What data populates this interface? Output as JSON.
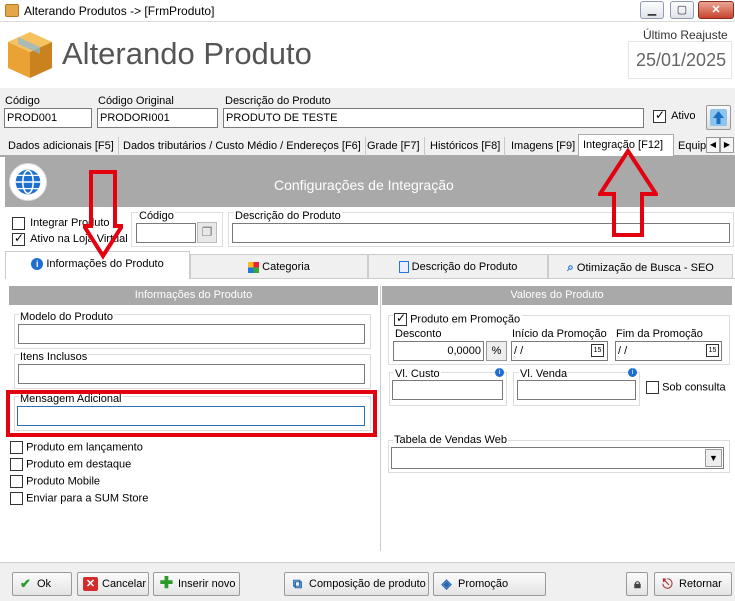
{
  "window": {
    "title": "Alterando Produtos  ->  [FrmProduto]",
    "minimize": "▁",
    "maximize": "▢",
    "close": "✕"
  },
  "header": {
    "page_title": "Alterando Produto",
    "reajuste_label": "Último Reajuste",
    "reajuste_value": "25/01/2025"
  },
  "fields": {
    "codigo_label": "Código",
    "codigo_value": "PROD001",
    "codigo_original_label": "Código Original",
    "codigo_original_value": "PRODORI001",
    "descricao_label": "Descrição do Produto",
    "descricao_value": "PRODUTO DE TESTE",
    "ativo_label": "Ativo"
  },
  "tabs": [
    {
      "label": "Dados adicionais [F5]"
    },
    {
      "label": "Dados tributários / Custo Médio / Endereços [F6]"
    },
    {
      "label": "Grade [F7]"
    },
    {
      "label": "Históricos [F8]"
    },
    {
      "label": "Imagens [F9]"
    },
    {
      "label": "Integração [F12]"
    },
    {
      "label": "Equip"
    }
  ],
  "integracao": {
    "title": "Configurações de Integração",
    "integrar_produto": "Integrar Produto",
    "ativo_loja_virtual": "Ativo na Loja Virtual",
    "codigo_label": "Código",
    "descricao_label": "Descrição do Produto"
  },
  "subtabs": [
    {
      "label": "Informações do Produto"
    },
    {
      "label": "Categoria"
    },
    {
      "label": "Descrição do Produto"
    },
    {
      "label": "Otimização de Busca - SEO"
    }
  ],
  "info_produto": {
    "header": "Informações do Produto",
    "modelo_label": "Modelo do Produto",
    "itens_label": "Itens Inclusos",
    "mensagem_label": "Mensagem Adicional",
    "checks": [
      "Produto em lançamento",
      "Produto em destaque",
      "Produto Mobile",
      "Enviar para a SUM Store"
    ]
  },
  "valores": {
    "header": "Valores do Produto",
    "promocao_label": "Produto em Promoção",
    "desconto_label": "Desconto",
    "desconto_value": "0,0000",
    "percent": "%",
    "inicio_label": "Início da Promoção",
    "inicio_value": " / /",
    "fim_label": "Fim da Promoção",
    "fim_value": " / /",
    "custo_label": "Vl. Custo",
    "venda_label": "Vl. Venda",
    "sob_consulta": "Sob consulta",
    "tabela_label": "Tabela de Vendas Web"
  },
  "buttons": {
    "ok": "Ok",
    "cancelar": "Cancelar",
    "inserir": "Inserir novo",
    "composicao": "Composição de produto",
    "promocao": "Promoção",
    "retornar": "Retornar"
  },
  "colors": {
    "highlight": "#e3000f",
    "panel_header": "#a9a9a9",
    "info_icon": "#1e6fd0"
  }
}
